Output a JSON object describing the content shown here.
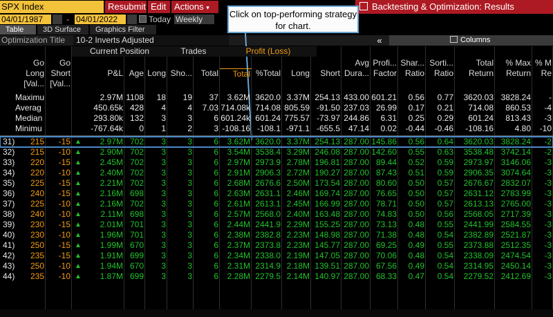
{
  "toolbar": {
    "ticker": "SPX Index",
    "resubmit": "Resubmit",
    "edit": "Edit",
    "actions": "Actions",
    "actions_caret": "▾",
    "title": "Backtesting & Optimization: Results",
    "start_date": "04/01/1987",
    "date_sep": "-",
    "end_date": "04/01/2022",
    "today": "Today",
    "frequency": "Weekly"
  },
  "tabs": [
    "Table",
    "3D Surface",
    "Graphics Filter"
  ],
  "optimization": {
    "label": "Optimization Title",
    "value": "10-2 Inverts Adjusted"
  },
  "columns_button": "Columns",
  "tooltip": "Click on top-performing strategy for chart.",
  "colors": {
    "accent": "#f3c23b",
    "red": "#ad1a23",
    "green": "#22c22c",
    "orange": "#f39c12",
    "highlight": "#4a88c8"
  },
  "table": {
    "groups": {
      "current": "Current Position",
      "trades": "Trades",
      "profit": "Profit (Loss)"
    },
    "headers": [
      [
        "Go",
        "Long",
        "[Val..."
      ],
      [
        "Go",
        "Short",
        "[Val..."
      ],
      [
        "",
        "P&L",
        ""
      ],
      [
        "",
        "Age",
        ""
      ],
      [
        "",
        "Long",
        ""
      ],
      [
        "",
        "Sho...",
        ""
      ],
      [
        "",
        "Total",
        ""
      ],
      [
        "",
        "Total",
        ""
      ],
      [
        "",
        "%Total",
        ""
      ],
      [
        "",
        "Long",
        ""
      ],
      [
        "",
        "Short",
        ""
      ],
      [
        "Avg",
        "Dura...",
        ""
      ],
      [
        "Profi...",
        "Factor",
        ""
      ],
      [
        "Shar...",
        "Ratio",
        ""
      ],
      [
        "Sorti...",
        "Ratio",
        ""
      ],
      [
        "Total",
        "Return",
        ""
      ],
      [
        "% Max",
        "Return",
        ""
      ],
      [
        "% M",
        "Re",
        ""
      ]
    ],
    "summary": [
      [
        "Maximu",
        "",
        "2.97M",
        "1108",
        "18",
        "19",
        "37",
        "3.62M",
        "3620.0",
        "3.37M",
        "254.13",
        "433.00",
        "601.21",
        "0.56",
        "0.77",
        "3620.03",
        "3828.24",
        "-"
      ],
      [
        "Averag",
        "",
        "450.65k",
        "428",
        "4",
        "4",
        "7.03",
        "714.08k",
        "714.08",
        "805.59",
        "-91.50",
        "237.03",
        "26.99",
        "0.17",
        "0.21",
        "714.08",
        "860.53",
        "-4"
      ],
      [
        "Median",
        "",
        "293.80k",
        "132",
        "3",
        "3",
        "6",
        "601.24k",
        "601.24",
        "775.57",
        "-73.97",
        "244.86",
        "6.31",
        "0.25",
        "0.29",
        "601.24",
        "813.43",
        "-3"
      ],
      [
        "Minimu",
        "",
        "-767.64k",
        "0",
        "1",
        "2",
        "3",
        "-108.16",
        "-108.1",
        "-971.1",
        "-655.5",
        "47.14",
        "0.02",
        "-0.44",
        "-0.46",
        "-108.16",
        "4.80",
        "-10"
      ]
    ],
    "rows": [
      [
        "31)",
        "215",
        "-15",
        "▲",
        "2.97M",
        "702",
        "3",
        "3",
        "6",
        "3.62M",
        "3620.0",
        "3.37M",
        "254.13",
        "287.00",
        "145.86",
        "0.56",
        "0.64",
        "3620.03",
        "3828.24",
        "-2"
      ],
      [
        "32)",
        "215",
        "-10",
        "▲",
        "2.90M",
        "702",
        "3",
        "3",
        "6",
        "3.54M",
        "3538.4",
        "3.29M",
        "246.08",
        "287.00",
        "142.60",
        "0.55",
        "0.63",
        "3538.48",
        "3742.14",
        "-2"
      ],
      [
        "33)",
        "220",
        "-15",
        "▲",
        "2.45M",
        "702",
        "3",
        "3",
        "6",
        "2.97M",
        "2973.9",
        "2.78M",
        "196.81",
        "287.00",
        "89.44",
        "0.52",
        "0.59",
        "2973.97",
        "3146.06",
        "-3"
      ],
      [
        "34)",
        "220",
        "-10",
        "▲",
        "2.40M",
        "702",
        "3",
        "3",
        "6",
        "2.91M",
        "2906.3",
        "2.72M",
        "190.27",
        "287.00",
        "87.43",
        "0.51",
        "0.59",
        "2906.35",
        "3074.64",
        "-3"
      ],
      [
        "35)",
        "225",
        "-15",
        "▲",
        "2.21M",
        "702",
        "3",
        "3",
        "6",
        "2.68M",
        "2676.6",
        "2.50M",
        "173.54",
        "287.00",
        "80.60",
        "0.50",
        "0.57",
        "2676.67",
        "2832.07",
        "-3"
      ],
      [
        "36)",
        "240",
        "-15",
        "▲",
        "2.16M",
        "698",
        "3",
        "3",
        "6",
        "2.63M",
        "2631.1",
        "2.46M",
        "169.74",
        "287.00",
        "76.65",
        "0.50",
        "0.57",
        "2631.12",
        "2783.99",
        "-3"
      ],
      [
        "37)",
        "225",
        "-10",
        "▲",
        "2.16M",
        "702",
        "3",
        "3",
        "6",
        "2.61M",
        "2613.1",
        "2.45M",
        "166.99",
        "287.00",
        "78.71",
        "0.50",
        "0.57",
        "2613.13",
        "2765.00",
        "-3"
      ],
      [
        "38)",
        "240",
        "-10",
        "▲",
        "2.11M",
        "698",
        "3",
        "3",
        "6",
        "2.57M",
        "2568.0",
        "2.40M",
        "163.48",
        "287.00",
        "74.83",
        "0.50",
        "0.56",
        "2568.05",
        "2717.39",
        "-3"
      ],
      [
        "39)",
        "230",
        "-15",
        "▲",
        "2.01M",
        "701",
        "3",
        "3",
        "6",
        "2.44M",
        "2441.9",
        "2.29M",
        "155.25",
        "287.00",
        "73.13",
        "0.48",
        "0.55",
        "2441.99",
        "2584.55",
        "-3"
      ],
      [
        "40)",
        "230",
        "-10",
        "▲",
        "1.96M",
        "701",
        "3",
        "3",
        "6",
        "2.38M",
        "2382.8",
        "2.23M",
        "148.98",
        "287.00",
        "71.38",
        "0.48",
        "0.54",
        "2382.89",
        "2521.87",
        "-3"
      ],
      [
        "41)",
        "250",
        "-15",
        "▲",
        "1.99M",
        "670",
        "3",
        "3",
        "6",
        "2.37M",
        "2373.8",
        "2.23M",
        "145.77",
        "287.00",
        "69.25",
        "0.49",
        "0.55",
        "2373.88",
        "2512.35",
        "-3"
      ],
      [
        "42)",
        "235",
        "-15",
        "▲",
        "1.91M",
        "699",
        "3",
        "3",
        "6",
        "2.34M",
        "2338.0",
        "2.19M",
        "147.05",
        "287.00",
        "70.06",
        "0.48",
        "0.54",
        "2338.09",
        "2474.54",
        "-3"
      ],
      [
        "43)",
        "250",
        "-10",
        "▲",
        "1.94M",
        "670",
        "3",
        "3",
        "6",
        "2.31M",
        "2314.9",
        "2.18M",
        "139.51",
        "287.00",
        "67.56",
        "0.49",
        "0.54",
        "2314.95",
        "2450.14",
        "-3"
      ],
      [
        "44)",
        "235",
        "-10",
        "▲",
        "1.87M",
        "699",
        "3",
        "3",
        "6",
        "2.28M",
        "2279.5",
        "2.14M",
        "140.97",
        "287.00",
        "68.33",
        "0.47",
        "0.54",
        "2279.52",
        "2412.69",
        "-3"
      ]
    ]
  }
}
